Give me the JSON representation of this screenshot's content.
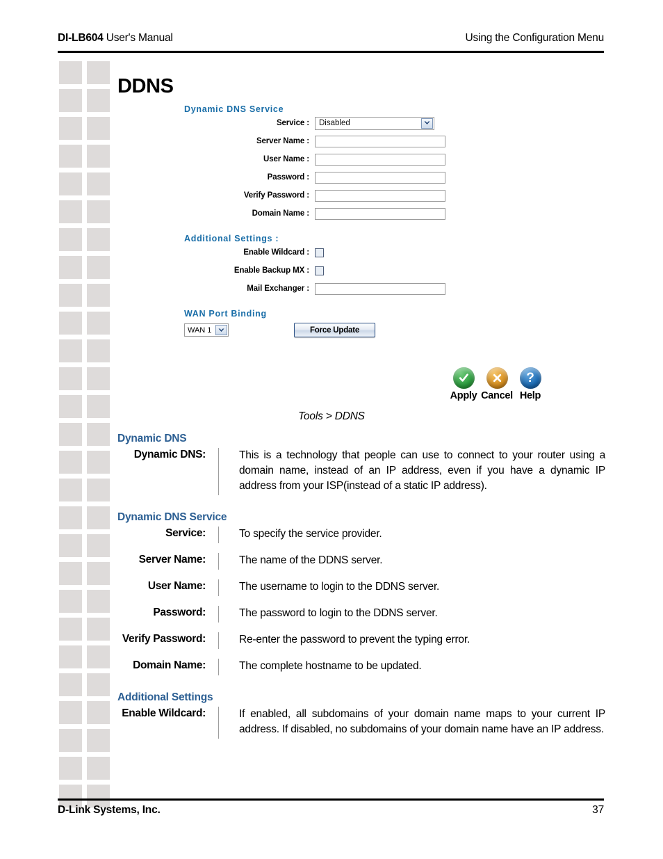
{
  "header": {
    "manual_title_bold": "DI-LB604",
    "manual_title_rest": " User's Manual",
    "section_title": "Using the Configuration Menu"
  },
  "page_title": "DDNS",
  "config_screen": {
    "dynamic_dns_service_heading": "Dynamic DNS Service",
    "fields": [
      {
        "label": "Service :",
        "type": "select",
        "value": "Disabled"
      },
      {
        "label": "Server Name :",
        "type": "text",
        "value": ""
      },
      {
        "label": "User Name :",
        "type": "text",
        "value": ""
      },
      {
        "label": "Password :",
        "type": "text",
        "value": ""
      },
      {
        "label": "Verify Password :",
        "type": "text",
        "value": ""
      },
      {
        "label": "Domain Name :",
        "type": "text",
        "value": ""
      }
    ],
    "additional_settings_heading": "Additional Settings :",
    "additional_fields": [
      {
        "label": "Enable Wildcard :",
        "type": "checkbox",
        "checked": false
      },
      {
        "label": "Enable Backup MX :",
        "type": "checkbox",
        "checked": false
      },
      {
        "label": "Mail Exchanger :",
        "type": "text",
        "value": ""
      }
    ],
    "wan_port_binding_heading": "WAN Port Binding",
    "wan_select_value": "WAN 1",
    "force_update_label": "Force Update",
    "actions": [
      {
        "label": "Apply",
        "icon": "check-circle-icon",
        "color": "#2d9e3f",
        "glyph": "✓"
      },
      {
        "label": "Cancel",
        "icon": "x-circle-icon",
        "color": "#d89020",
        "glyph": "✕"
      },
      {
        "label": "Help",
        "icon": "question-circle-icon",
        "color": "#1c6cb5",
        "glyph": "?"
      }
    ]
  },
  "caption": "Tools > DDNS",
  "sections": [
    {
      "heading": "Dynamic DNS",
      "items": [
        {
          "term": "Dynamic DNS:",
          "description": "This is a technology that people can use to connect to your router using a domain name, instead of an IP address, even if you have a dynamic IP address from your ISP(instead of a static IP address)."
        }
      ]
    },
    {
      "heading": "Dynamic DNS Service",
      "items": [
        {
          "term": "Service:",
          "description": "To specify the service provider."
        },
        {
          "term": "Server Name:",
          "description": "The name of the DDNS server."
        },
        {
          "term": "User Name:",
          "description": "The username to login to the DDNS server."
        },
        {
          "term": "Password:",
          "description": "The password to login to the DDNS server."
        },
        {
          "term": "Verify Password:",
          "description": "Re-enter the password to prevent the typing error."
        },
        {
          "term": "Domain Name:",
          "description": "The complete hostname to be updated."
        }
      ]
    },
    {
      "heading": "Additional Settings",
      "items": [
        {
          "term": "Enable Wildcard:",
          "description": "If enabled, all subdomains of your domain name maps to your current IP address. If disabled, no subdomains of your domain name have an IP address."
        }
      ]
    }
  ],
  "footer": {
    "company": "D-Link Systems, Inc.",
    "page_number": "37"
  }
}
